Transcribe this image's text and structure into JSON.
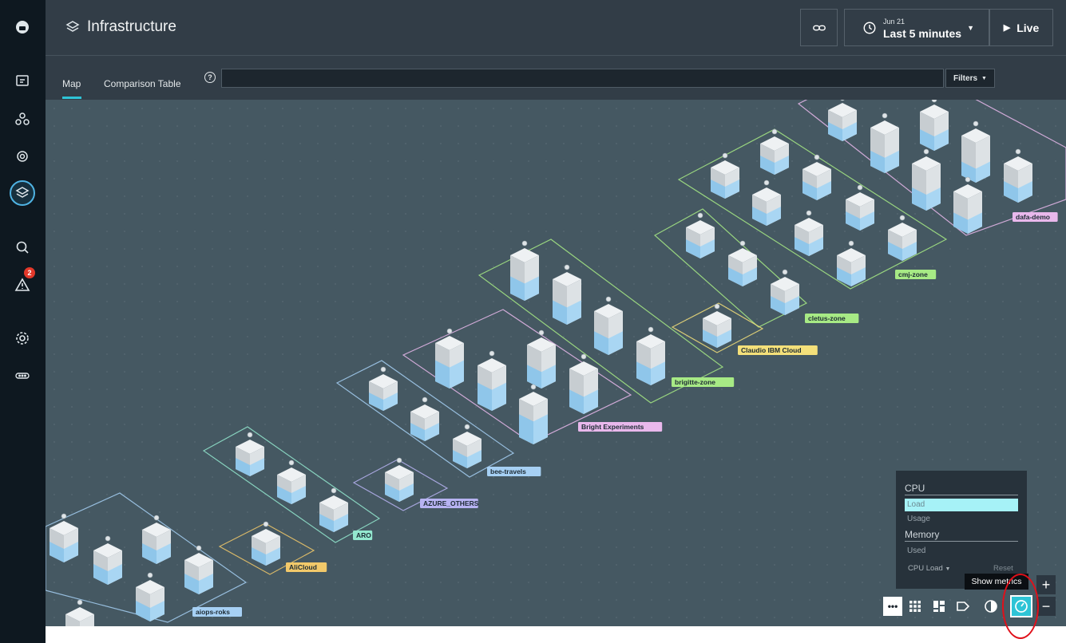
{
  "header": {
    "title": "Infrastructure",
    "time_date": "Jun 21",
    "time_range": "Last 5 minutes",
    "live_label": "Live"
  },
  "tabs": [
    {
      "label": "Map",
      "active": true
    },
    {
      "label": "Comparison Table",
      "active": false
    }
  ],
  "search": {
    "value": "",
    "placeholder": ""
  },
  "filters_label": "Filters",
  "rail": {
    "icons": [
      "monitor-icon",
      "applications-icon",
      "platforms-icon",
      "infrastructure-icon",
      "analytics-icon",
      "alerts-icon",
      "settings-icon",
      "more-icon"
    ],
    "alert_count": "2",
    "active": "infrastructure-icon"
  },
  "zones": [
    {
      "label": "dafa-demo",
      "color": "#e9b8ec"
    },
    {
      "label": "cmj-zone",
      "color": "#a7ea85"
    },
    {
      "label": "cletus-zone",
      "color": "#a7ea85"
    },
    {
      "label": "Claudio IBM Cloud",
      "color": "#f4e07a"
    },
    {
      "label": "brigitte-zone",
      "color": "#a7ea85"
    },
    {
      "label": "Bright Experiments",
      "color": "#e9b8ec"
    },
    {
      "label": "bee-travels",
      "color": "#a6d0f4"
    },
    {
      "label": "AZURE_OTHERS",
      "color": "#b7b3f2"
    },
    {
      "label": "ARO",
      "color": "#93e8cf"
    },
    {
      "label": "AliCloud",
      "color": "#f2c96a"
    },
    {
      "label": "aiops-roks",
      "color": "#a6d0f4"
    }
  ],
  "metrics_panel": {
    "cpu_heading": "CPU",
    "cpu_items": [
      {
        "label": "Load",
        "selected": true
      },
      {
        "label": "Usage",
        "selected": false
      }
    ],
    "memory_heading": "Memory",
    "memory_items": [
      {
        "label": "Used",
        "selected": false
      }
    ],
    "selected_metric": "CPU Load",
    "reset_label": "Reset"
  },
  "tooltip": "Show metrics",
  "toolbar": {
    "buttons": [
      "more-icon",
      "grid-icon",
      "layout-icon",
      "tag-icon",
      "contrast-icon",
      "metrics-icon"
    ],
    "zoom_in": "+",
    "zoom_out": "−"
  }
}
